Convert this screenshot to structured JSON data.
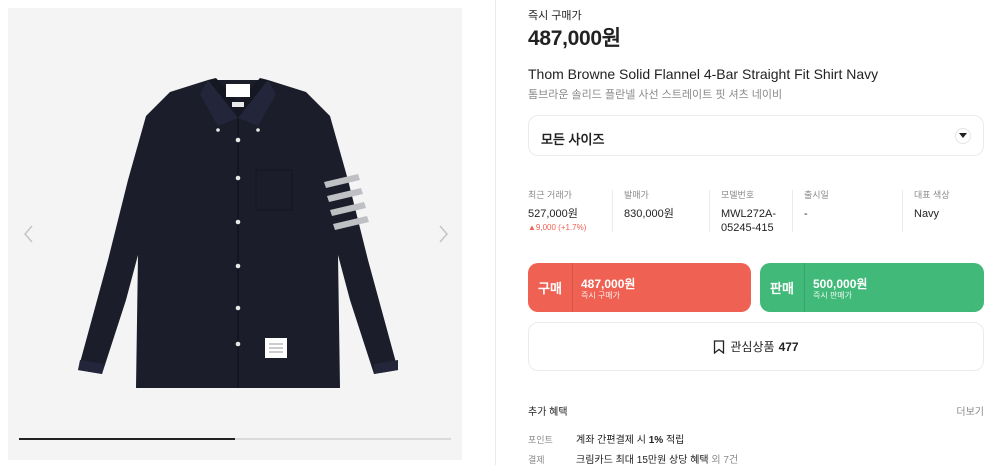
{
  "gallery": {
    "prev_label": "‹",
    "next_label": "›",
    "progress": 0.5
  },
  "product": {
    "price_label": "즉시 구매가",
    "price": "487,000원",
    "title_en": "Thom Browne Solid Flannel 4-Bar Straight Fit Shirt Navy",
    "title_ko": "톰브라운 솔리드 플란넬 사선 스트레이트 핏 셔츠 네이비"
  },
  "size_select": {
    "label": "모든 사이즈"
  },
  "stats": [
    {
      "header": "최근 거래가",
      "value": "527,000원",
      "delta": "▲9,000 (+1.7%)"
    },
    {
      "header": "발매가",
      "value": "830,000원"
    },
    {
      "header": "모델번호",
      "value_lines": [
        "MWL272A-",
        "05245-415"
      ]
    },
    {
      "header": "출시일",
      "value": "-"
    },
    {
      "header": "대표 색상",
      "value": "Navy"
    }
  ],
  "buy": {
    "kind": "구매",
    "amount": "487,000원",
    "sub": "즉시 구매가"
  },
  "sell": {
    "kind": "판매",
    "amount": "500,000원",
    "sub": "즉시 판매가"
  },
  "wish": {
    "label": "관심상품",
    "count": "477"
  },
  "benefits": {
    "title": "추가 혜택",
    "more": "더보기",
    "rows": [
      {
        "key": "포인트",
        "pre": "계좌 간편결제 시 ",
        "bold": "1%",
        "post": " 적립",
        "extra": ""
      },
      {
        "key": "결제",
        "pre": "크림카드 최대 15만원 상당 혜택",
        "bold": "",
        "post": "",
        "extra": " 외 7건"
      }
    ]
  },
  "colors": {
    "buy": "#ef6253",
    "sell": "#41b979",
    "shirt": "#1b1d2a",
    "stripes": "#bfc0c4"
  },
  "icons": {
    "prev": "chevron-left-icon",
    "next": "chevron-right-icon",
    "caret": "caret-down-icon",
    "wish": "bookmark-icon"
  }
}
